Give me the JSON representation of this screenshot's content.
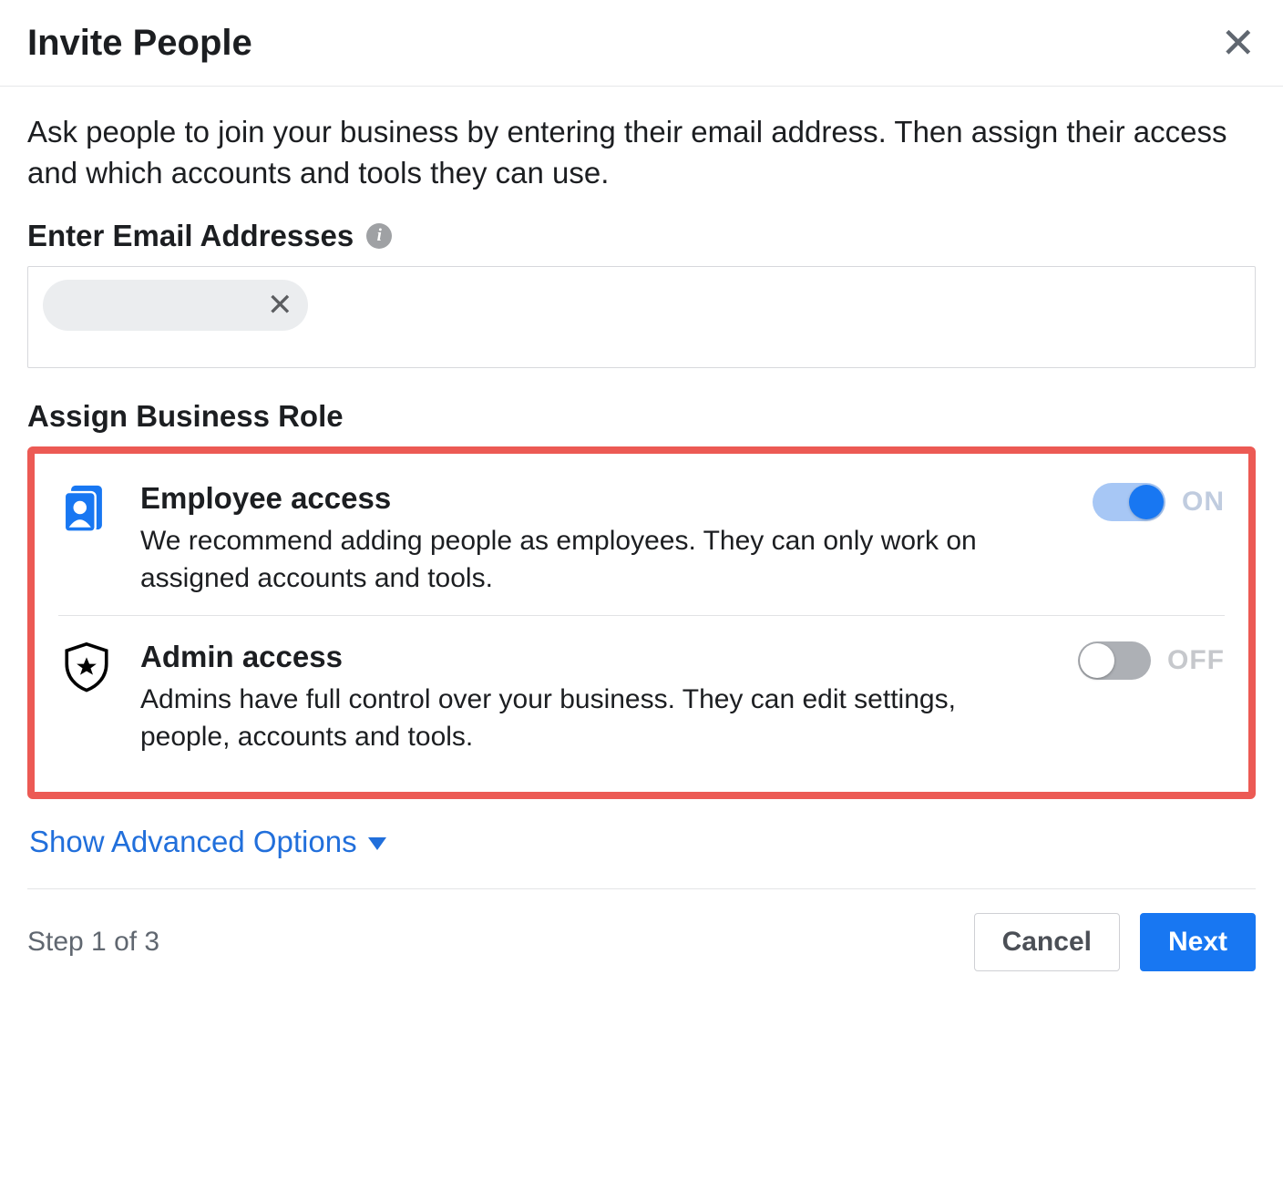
{
  "dialog": {
    "title": "Invite People",
    "intro": "Ask people to join your business by entering their email address. Then assign their access and which accounts and tools they can use.",
    "emailSection": {
      "heading": "Enter Email Addresses",
      "chipValue": ""
    },
    "roleSection": {
      "heading": "Assign Business Role",
      "roles": {
        "employee": {
          "title": "Employee access",
          "description": "We recommend adding people as employees. They can only work on assigned accounts and tools.",
          "toggleState": "ON"
        },
        "admin": {
          "title": "Admin access",
          "description": "Admins have full control over your business. They can edit settings, people, accounts and tools.",
          "toggleState": "OFF"
        }
      }
    },
    "advancedLink": "Show Advanced Options",
    "footer": {
      "stepText": "Step 1 of 3",
      "cancel": "Cancel",
      "next": "Next"
    }
  }
}
